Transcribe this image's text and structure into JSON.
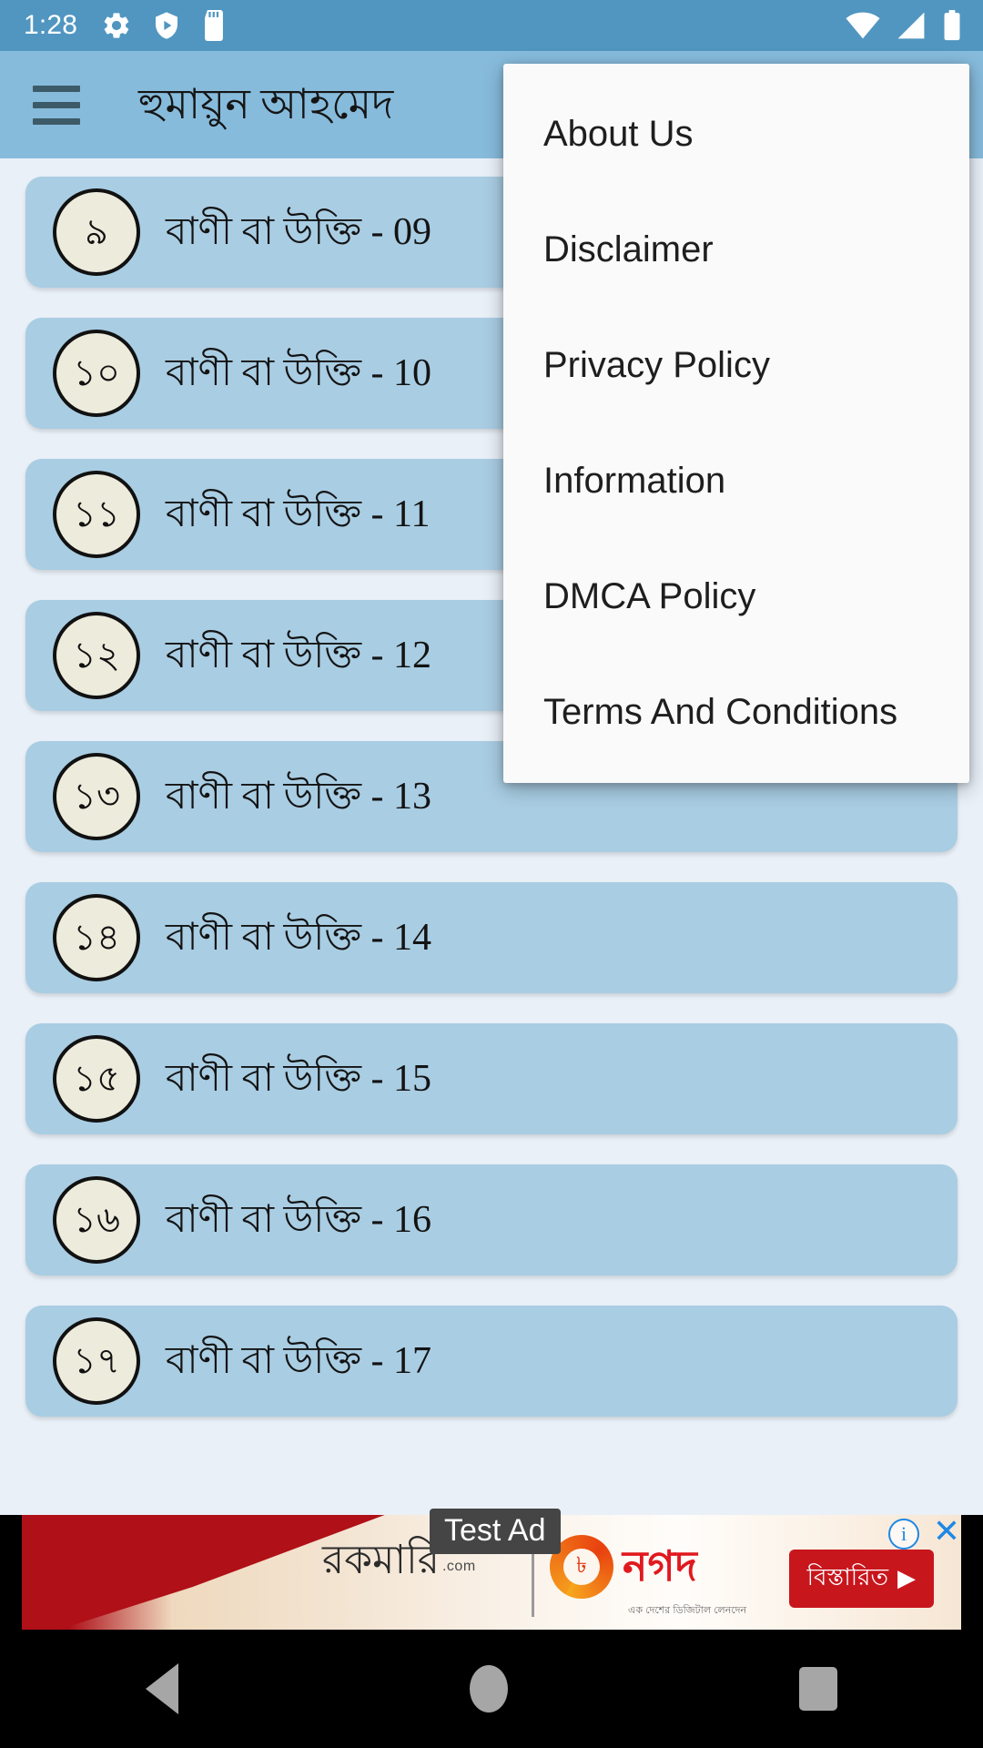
{
  "status_bar": {
    "clock": "1:28",
    "left_icons": [
      "gear-icon",
      "play-protect-shield-icon",
      "sd-card-icon"
    ],
    "right_icons": [
      "wifi-icon",
      "cellular-signal-icon",
      "battery-icon"
    ],
    "background_color": "#5096C0"
  },
  "app_bar": {
    "menu_icon": "hamburger-menu-icon",
    "title": "হুমায়ুন আহমেদ",
    "background_color": "#87BBDC"
  },
  "overflow_menu": {
    "visible": true,
    "background_color": "#FAFAFA",
    "items": [
      {
        "label": "About Us"
      },
      {
        "label": "Disclaimer"
      },
      {
        "label": "Privacy Policy"
      },
      {
        "label": "Information"
      },
      {
        "label": "DMCA Policy"
      },
      {
        "label": "Terms And Conditions"
      }
    ]
  },
  "list": {
    "background_color": "#E9F0F8",
    "item_color": "#A9CDE3",
    "badge_color": "#EDEBDC",
    "items": [
      {
        "badge": "৯",
        "label": "বাণী বা উক্তি - 09"
      },
      {
        "badge": "১০",
        "label": "বাণী বা উক্তি - 10"
      },
      {
        "badge": "১১",
        "label": "বাণী বা উক্তি - 11"
      },
      {
        "badge": "১২",
        "label": "বাণী বা উক্তি - 12"
      },
      {
        "badge": "১৩",
        "label": "বাণী বা উক্তি - 13"
      },
      {
        "badge": "১৪",
        "label": "বাণী বা উক্তি - 14"
      },
      {
        "badge": "১৫",
        "label": "বাণী বা উক্তি - 15"
      },
      {
        "badge": "১৬",
        "label": "বাণী বা উক্তি - 16"
      },
      {
        "badge": "১৭",
        "label": "বাণী বা উক্তি - 17"
      }
    ]
  },
  "ad_banner": {
    "test_label": "Test Ad",
    "advertiser_text": "রকমারি",
    "advertiser_domain": ".com",
    "partner_text": "নগদ",
    "partner_sub": "এক দেশের ডিজিটাল লেনদেন",
    "cta_label": "বিস্তারিত",
    "cta_arrow": "▶",
    "info_icon": "ad-info-icon",
    "close_icon": "ad-close-icon"
  },
  "nav_bar": {
    "back": "back-triangle-icon",
    "home": "home-circle-icon",
    "recents": "recents-square-icon",
    "background_color": "#000000"
  }
}
